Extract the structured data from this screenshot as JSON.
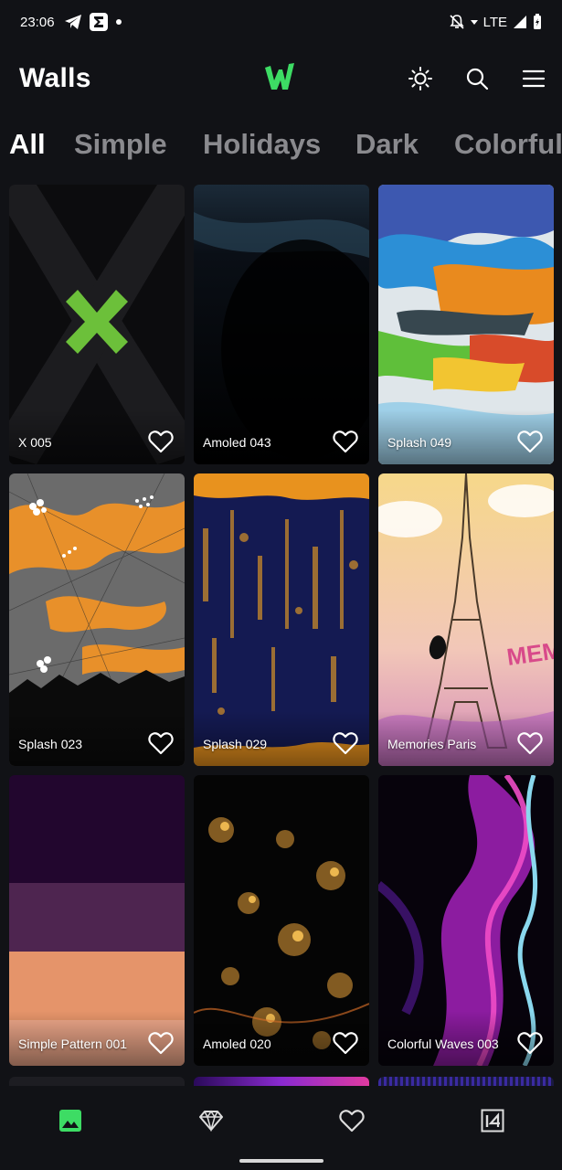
{
  "status_bar": {
    "time": "23:06",
    "network": "LTE",
    "icons": [
      "telegram-icon",
      "sigma-app-icon",
      "dot-icon",
      "bell-off-icon",
      "wifi-arrow-icon",
      "signal-icon",
      "battery-icon"
    ]
  },
  "app_bar": {
    "title": "Walls",
    "logo": "walls-logo",
    "actions": [
      "theme-brightness-icon",
      "search-icon",
      "menu-icon"
    ],
    "brand_color": "#3ddc64"
  },
  "tabs": [
    {
      "label": "All",
      "active": true
    },
    {
      "label": "Simple",
      "active": false
    },
    {
      "label": "Holidays",
      "active": false
    },
    {
      "label": "Dark",
      "active": false
    },
    {
      "label": "Colorful",
      "active": false
    }
  ],
  "wallpapers": [
    {
      "name": "X 005"
    },
    {
      "name": "Amoled 043"
    },
    {
      "name": "Splash 049"
    },
    {
      "name": "Splash 023"
    },
    {
      "name": "Splash 029"
    },
    {
      "name": "Memories Paris"
    },
    {
      "name": "Simple Pattern 001"
    },
    {
      "name": "Amoled 020"
    },
    {
      "name": "Colorful Waves 003"
    }
  ],
  "bottom_nav": [
    {
      "icon": "wallpapers-icon",
      "active": true
    },
    {
      "icon": "premium-diamond-icon",
      "active": false
    },
    {
      "icon": "favorites-heart-icon",
      "active": false
    },
    {
      "icon": "widget-14-icon",
      "active": false
    }
  ],
  "colors": {
    "background": "#111216",
    "accent": "#3ddc64",
    "inactive_tab": "#8a8a8e"
  }
}
